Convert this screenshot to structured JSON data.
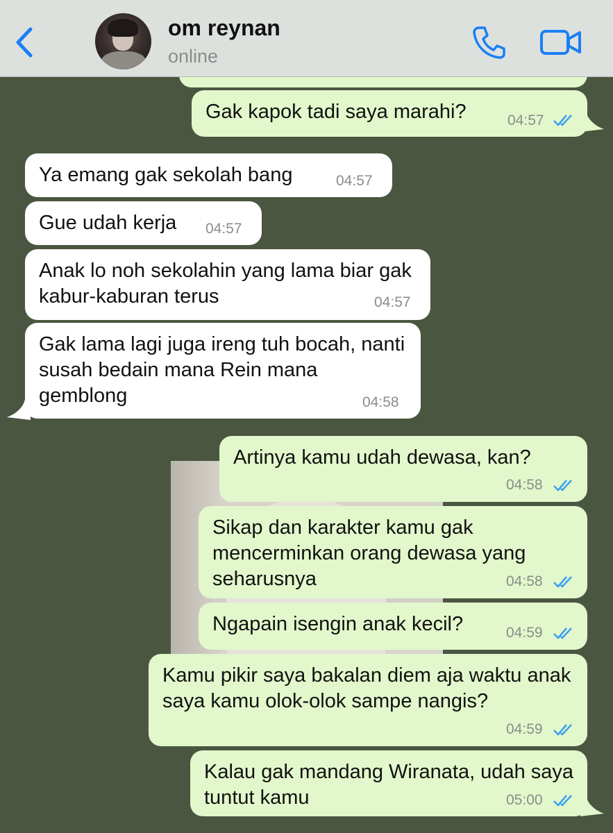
{
  "header": {
    "contact_name": "om reynan",
    "contact_status": "online",
    "back_icon": "chevron-left-icon",
    "call_icon": "phone-icon",
    "video_icon": "video-camera-icon"
  },
  "colors": {
    "accent": "#1a7ff5",
    "chat_background": "#4a5640",
    "incoming_bubble": "#ffffff",
    "outgoing_bubble": "#e2f7cb",
    "read_ticks": "#3aa0f0"
  },
  "messages": [
    {
      "direction": "out",
      "text": "Gak kapok tadi saya marahi?",
      "time": "04:57",
      "status": "read"
    },
    {
      "direction": "in",
      "text": "Ya emang gak sekolah bang",
      "time": "04:57"
    },
    {
      "direction": "in",
      "text": "Gue udah kerja",
      "time": "04:57"
    },
    {
      "direction": "in",
      "text": "Anak lo noh sekolahin yang lama biar gak kabur-kaburan terus",
      "time": "04:57"
    },
    {
      "direction": "in",
      "text": "Gak lama lagi juga ireng tuh bocah, nanti susah bedain mana Rein mana gemblong",
      "time": "04:58"
    },
    {
      "direction": "out",
      "text": "Artinya kamu udah dewasa, kan?",
      "time": "04:58",
      "status": "read"
    },
    {
      "direction": "out",
      "text": "Sikap dan karakter kamu gak mencerminkan orang dewasa yang seharusnya",
      "time": "04:58",
      "status": "read"
    },
    {
      "direction": "out",
      "text": "Ngapain isengin anak kecil?",
      "time": "04:59",
      "status": "read"
    },
    {
      "direction": "out",
      "text": "Kamu pikir saya bakalan diem aja waktu anak saya kamu olok-olok sampe nangis?",
      "time": "04:59",
      "status": "read"
    },
    {
      "direction": "out",
      "text": "Kalau gak mandang Wiranata, udah saya tuntut kamu",
      "time": "05:00",
      "status": "read"
    }
  ]
}
